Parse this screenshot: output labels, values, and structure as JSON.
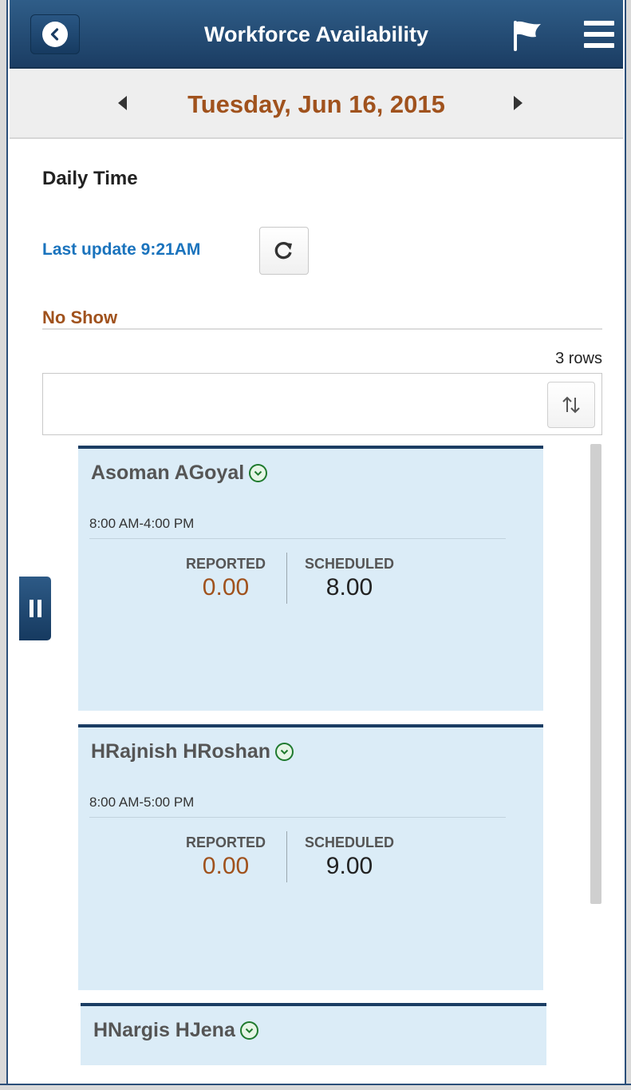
{
  "header": {
    "title": "Workforce Availability",
    "back_icon": "back-chevron-icon",
    "flag_icon": "flag-icon",
    "menu_icon": "hamburger-menu-icon",
    "accent": "#1b3d63"
  },
  "datebar": {
    "date": "Tuesday, Jun 16, 2015",
    "date_color": "#a0521d"
  },
  "section": {
    "title": "Daily Time",
    "last_update": "Last update 9:21AM"
  },
  "group": {
    "title": "No Show",
    "rows_count": "3 rows"
  },
  "cards": [
    {
      "name": "Asoman AGoyal",
      "time": "8:00 AM-4:00 PM",
      "reported_label": "REPORTED",
      "reported_value": "0.00",
      "scheduled_label": "SCHEDULED",
      "scheduled_value": "8.00"
    },
    {
      "name": "HRajnish HRoshan",
      "time": "8:00 AM-5:00 PM",
      "reported_label": "REPORTED",
      "reported_value": "0.00",
      "scheduled_label": "SCHEDULED",
      "scheduled_value": "9.00"
    },
    {
      "name": "HNargis HJena"
    }
  ]
}
